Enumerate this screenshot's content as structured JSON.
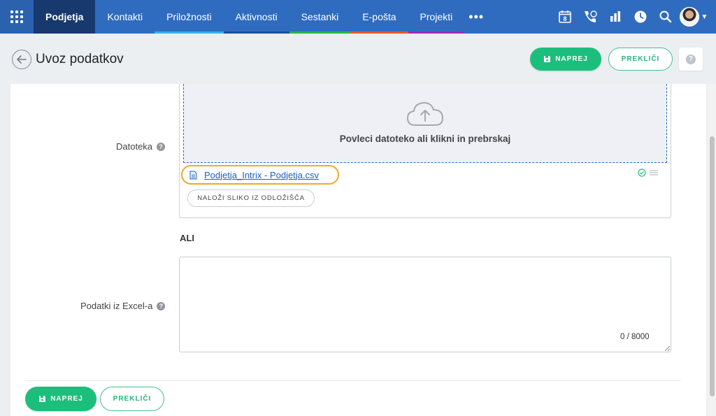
{
  "nav": {
    "tabs": [
      {
        "label": "Podjetja",
        "active": true,
        "accent": ""
      },
      {
        "label": "Kontakti",
        "active": false,
        "accent": "#2f6cc0"
      },
      {
        "label": "Priložnosti",
        "active": false,
        "accent": "#3ab0e6"
      },
      {
        "label": "Aktivnosti",
        "active": false,
        "accent": "#1e4f99"
      },
      {
        "label": "Sestanki",
        "active": false,
        "accent": "#2bb34a"
      },
      {
        "label": "E-pošta",
        "active": false,
        "accent": "#ea5a2b"
      },
      {
        "label": "Projekti",
        "active": false,
        "accent": "#9b2fb2"
      }
    ],
    "more": "•••",
    "calendar_day": "8",
    "icons": [
      "apps-grid-icon",
      "calendar-icon",
      "call-icon",
      "reports-icon",
      "clock-icon",
      "search-icon",
      "avatar",
      "chevron-down-icon"
    ]
  },
  "header": {
    "title": "Uvoz podatkov",
    "next_label": "NAPREJ",
    "cancel_label": "PREKLIČI",
    "help": "?"
  },
  "form": {
    "file_label": "Datoteka",
    "file_help": "?",
    "drop_text": "Povleci datoteko ali klikni in prebrskaj",
    "file_name": "Podjetja_Intrix - Podjetja.csv",
    "upload_clipboard_label": "NALOŽI SLIKO IZ ODLOŽIŠČA",
    "or_label": "ALI",
    "excel_label": "Podatki iz Excel-a",
    "excel_help": "?",
    "excel_value": "",
    "counter": "0 / 8000"
  },
  "footer": {
    "next_label": "NAPREJ",
    "cancel_label": "PREKLIČI"
  },
  "colors": {
    "primary_green": "#1bbf7b",
    "nav_blue": "#2f6cc0",
    "nav_active": "#17396e",
    "highlight": "#f4a926",
    "link": "#1a5fbf"
  }
}
